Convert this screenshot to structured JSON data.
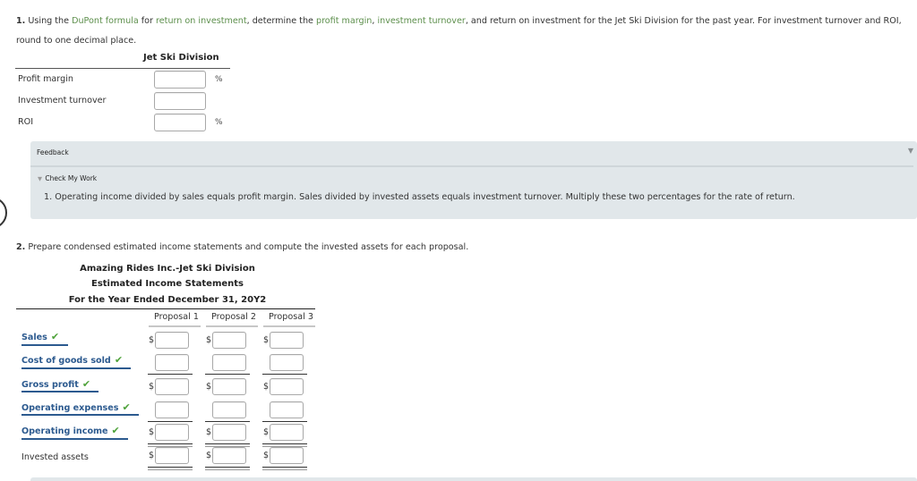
{
  "question1": {
    "number": "1.",
    "t1": " Using the ",
    "term1": "DuPont formula",
    "t2": " for ",
    "term2": "return on investment",
    "t3": ", determine the ",
    "term3": "profit margin",
    "t4": ", ",
    "term4": "investment turnover",
    "t5": ", and return on investment for the Jet Ski Division for the past year. For investment turnover and ROI, round to one decimal place."
  },
  "part1_table": {
    "column_header": "Jet Ski Division",
    "rows": [
      {
        "label": "Profit margin",
        "value": "",
        "unit": "%"
      },
      {
        "label": "Investment turnover",
        "value": "",
        "unit": ""
      },
      {
        "label": "ROI",
        "value": "",
        "unit": "%"
      }
    ]
  },
  "feedback": {
    "title": "Feedback",
    "toggle_icon": "▼",
    "check_label": "Check My Work",
    "check_icon": "▼",
    "message": "1. Operating income divided by sales equals profit margin. Sales divided by invested assets equals investment turnover. Multiply these two percentages for the rate of return."
  },
  "question2": {
    "number": "2.",
    "text": " Prepare condensed estimated income statements and compute the invested assets for each proposal."
  },
  "statement": {
    "company": "Amazing Rides Inc.-Jet Ski Division",
    "title": "Estimated Income Statements",
    "period": "For the Year Ended December 31, 20Y2",
    "columns": [
      "Proposal 1",
      "Proposal 2",
      "Proposal 3"
    ],
    "check_mark": "✔",
    "currency": "$",
    "rows": [
      {
        "label": "Sales",
        "checked": true,
        "values": [
          "",
          "",
          ""
        ]
      },
      {
        "label": "Cost of goods sold",
        "checked": true,
        "values": [
          "",
          "",
          ""
        ]
      },
      {
        "label": "Gross profit",
        "checked": true,
        "values": [
          "",
          "",
          ""
        ]
      },
      {
        "label": "Operating expenses",
        "checked": true,
        "values": [
          "",
          "",
          ""
        ]
      },
      {
        "label": "Operating income",
        "checked": true,
        "values": [
          "",
          "",
          ""
        ]
      },
      {
        "label": "Invested assets",
        "checked": false,
        "values": [
          "",
          "",
          ""
        ]
      }
    ]
  },
  "colors": {
    "glossary_term": "#5d8f4c",
    "label_link": "#2c5a8f",
    "check_green": "#4ea23a",
    "feedback_bg": "#e1e7ea"
  }
}
